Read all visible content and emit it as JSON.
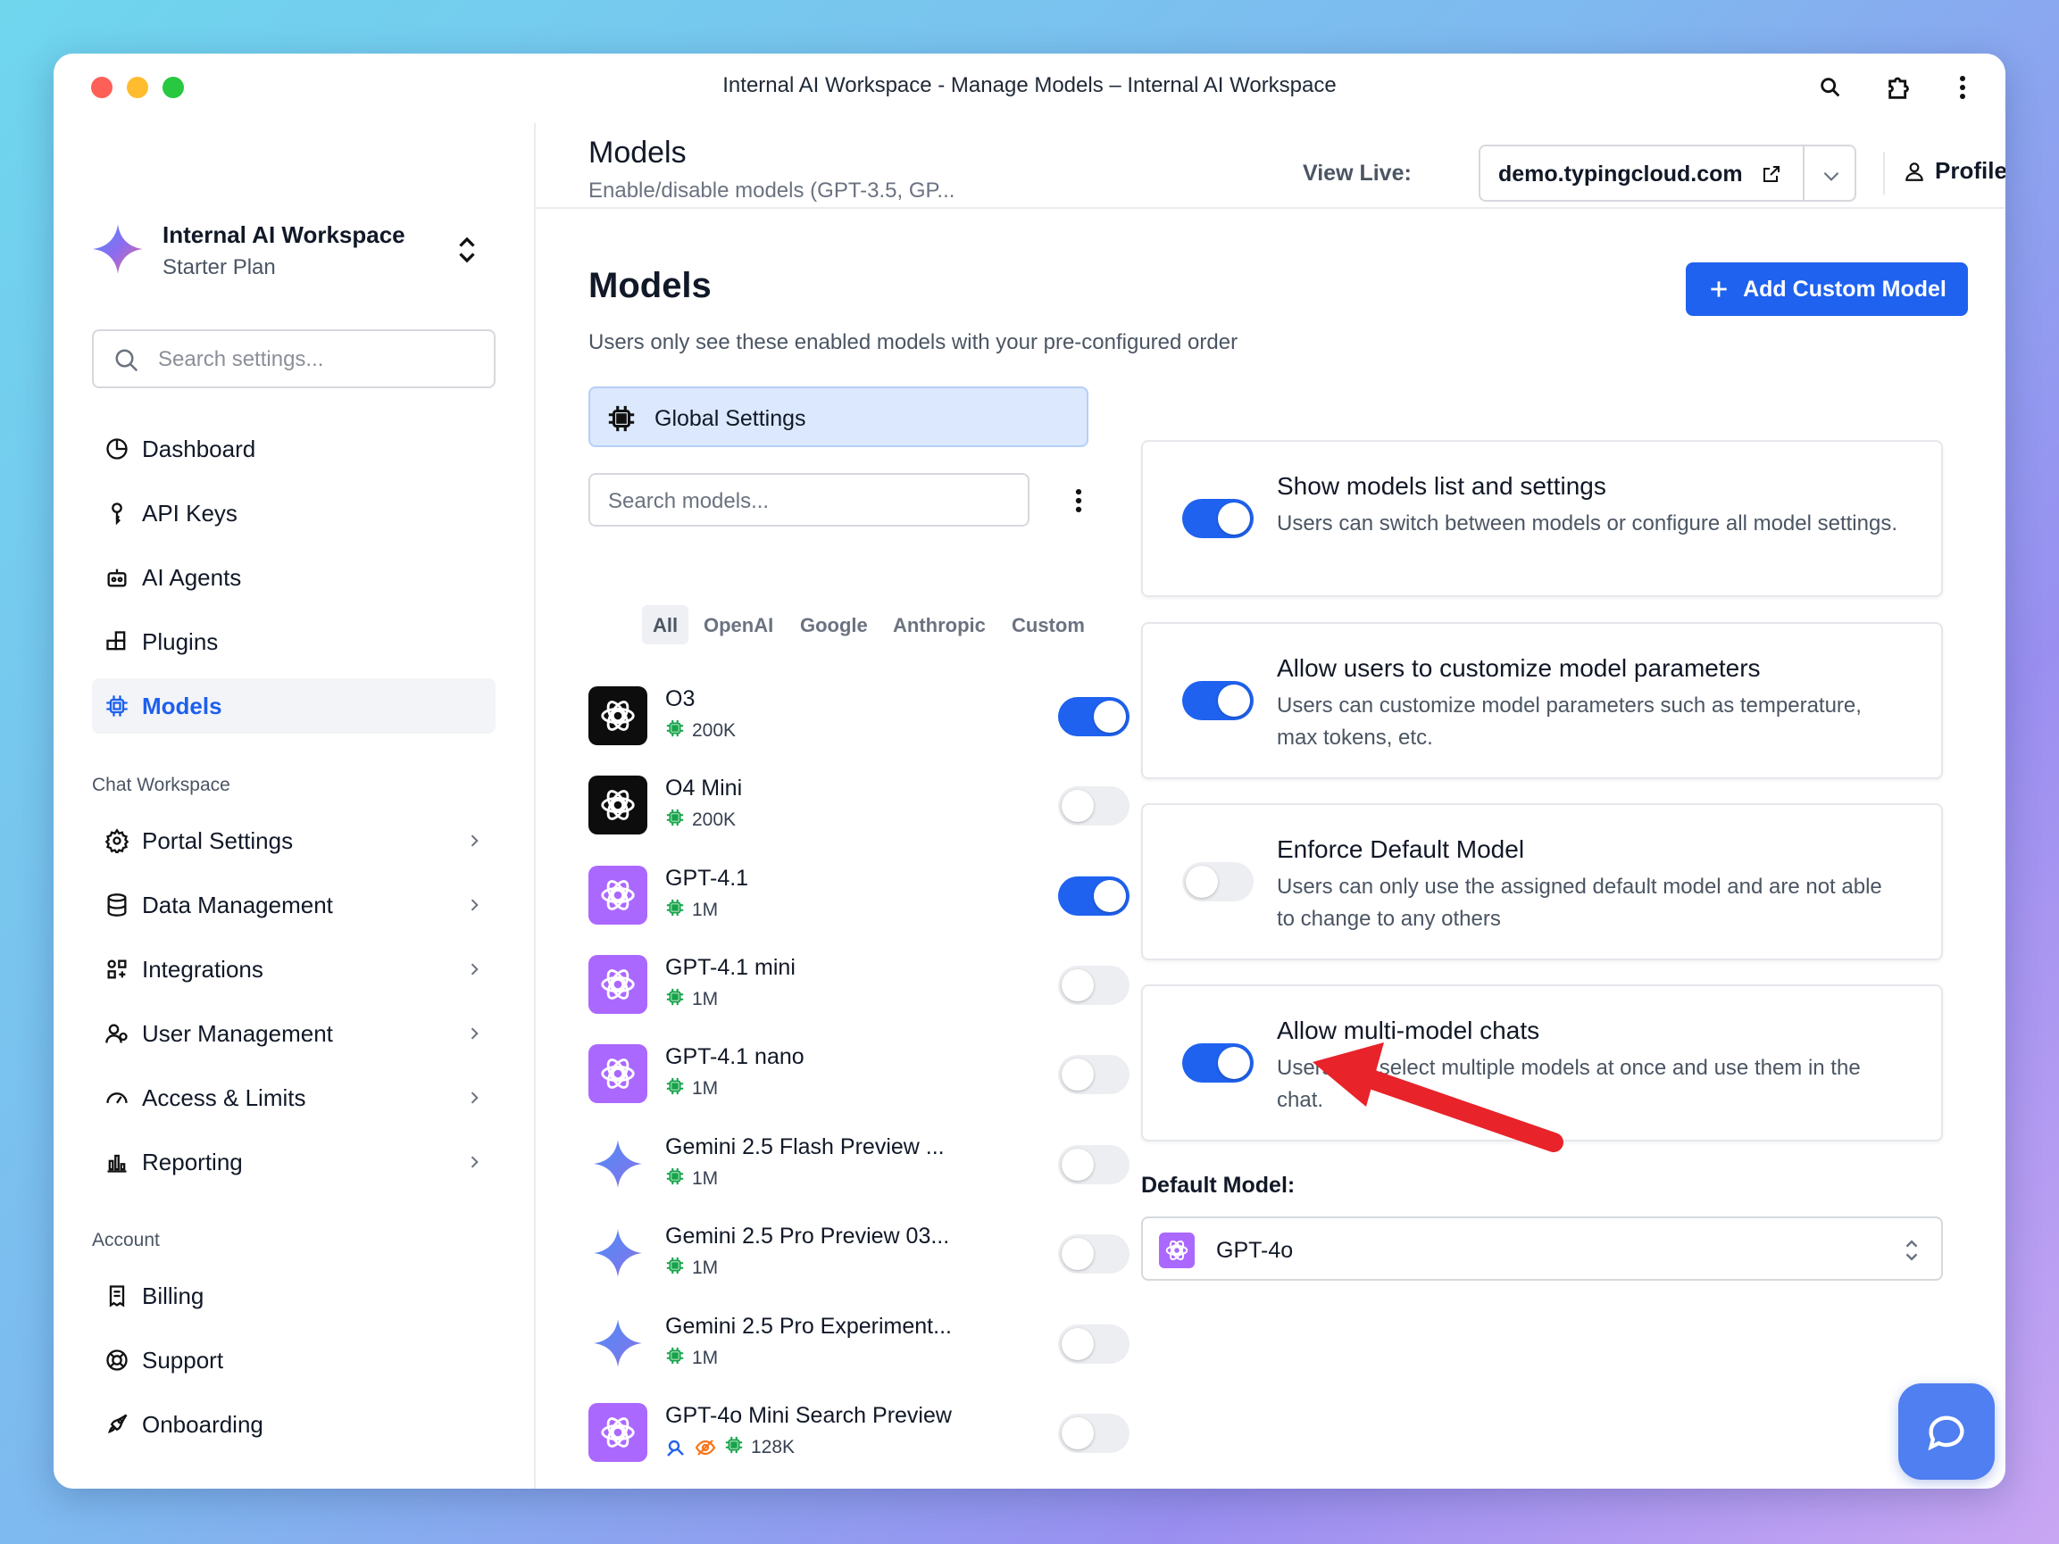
{
  "window": {
    "title": "Internal AI Workspace - Manage Models – Internal AI Workspace"
  },
  "workspace": {
    "name": "Internal AI Workspace",
    "plan": "Starter Plan"
  },
  "sidebar": {
    "search_placeholder": "Search settings...",
    "main_items": [
      {
        "label": "Dashboard",
        "icon": "pie-chart-icon"
      },
      {
        "label": "API Keys",
        "icon": "key-icon"
      },
      {
        "label": "AI Agents",
        "icon": "agent-icon"
      },
      {
        "label": "Plugins",
        "icon": "plugin-icon"
      },
      {
        "label": "Models",
        "icon": "chip-icon",
        "active": true
      }
    ],
    "chat_section_label": "Chat Workspace",
    "chat_items": [
      {
        "label": "Portal Settings",
        "icon": "gear-icon"
      },
      {
        "label": "Data Management",
        "icon": "database-icon"
      },
      {
        "label": "Integrations",
        "icon": "grid-icon"
      },
      {
        "label": "User Management",
        "icon": "users-icon"
      },
      {
        "label": "Access & Limits",
        "icon": "gauge-icon"
      },
      {
        "label": "Reporting",
        "icon": "bar-chart-icon"
      }
    ],
    "account_section_label": "Account",
    "account_items": [
      {
        "label": "Billing",
        "icon": "receipt-icon"
      },
      {
        "label": "Support",
        "icon": "lifebuoy-icon"
      },
      {
        "label": "Onboarding",
        "icon": "rocket-icon"
      }
    ]
  },
  "header": {
    "title": "Models",
    "subtitle": "Enable/disable models (GPT-3.5, GP...",
    "view_live_label": "View Live:",
    "live_url": "demo.typingcloud.com",
    "profile_label": "Profile"
  },
  "main": {
    "title": "Models",
    "description": "Users only see these enabled models with your pre-configured order",
    "add_button": "Add Custom Model",
    "global_settings_label": "Global Settings",
    "model_search_placeholder": "Search models...",
    "filter_tabs": [
      "All",
      "OpenAI",
      "Google",
      "Anthropic",
      "Custom"
    ],
    "active_filter": "All",
    "models": [
      {
        "name": "O3",
        "context": "200K",
        "provider": "openai-dark",
        "enabled": true
      },
      {
        "name": "O4 Mini",
        "context": "200K",
        "provider": "openai-dark",
        "enabled": false
      },
      {
        "name": "GPT-4.1",
        "context": "1M",
        "provider": "openai-purple",
        "enabled": true
      },
      {
        "name": "GPT-4.1 mini",
        "context": "1M",
        "provider": "openai-purple",
        "enabled": false
      },
      {
        "name": "GPT-4.1 nano",
        "context": "1M",
        "provider": "openai-purple",
        "enabled": false
      },
      {
        "name": "Gemini 2.5 Flash Preview ...",
        "context": "1M",
        "provider": "gemini",
        "enabled": false
      },
      {
        "name": "Gemini 2.5 Pro Preview 03...",
        "context": "1M",
        "provider": "gemini",
        "enabled": false
      },
      {
        "name": "Gemini 2.5 Pro Experiment...",
        "context": "1M",
        "provider": "gemini",
        "enabled": false
      },
      {
        "name": "GPT-4o Mini Search Preview",
        "context": "128K",
        "provider": "openai-purple",
        "enabled": false,
        "extra_badges": [
          "search-tool-icon",
          "vision-off-icon"
        ]
      }
    ],
    "settings": [
      {
        "title": "Show models list and settings",
        "description": "Users can switch between models or configure all model settings.",
        "enabled": true
      },
      {
        "title": "Allow users to customize model parameters",
        "description": "Users can customize model parameters such as temperature, max tokens, etc.",
        "enabled": true
      },
      {
        "title": "Enforce Default Model",
        "description": "Users can only use the assigned default model and are not able to change to any others",
        "enabled": false
      },
      {
        "title": "Allow multi-model chats",
        "description": "Users can select multiple models at once and use them in the chat.",
        "enabled": true
      }
    ],
    "default_model_label": "Default Model:",
    "default_model_value": "GPT-4o"
  },
  "colors": {
    "accent": "#1f62ef",
    "annotation_arrow": "#e8232a",
    "openai_purple": "#ab68ff"
  }
}
